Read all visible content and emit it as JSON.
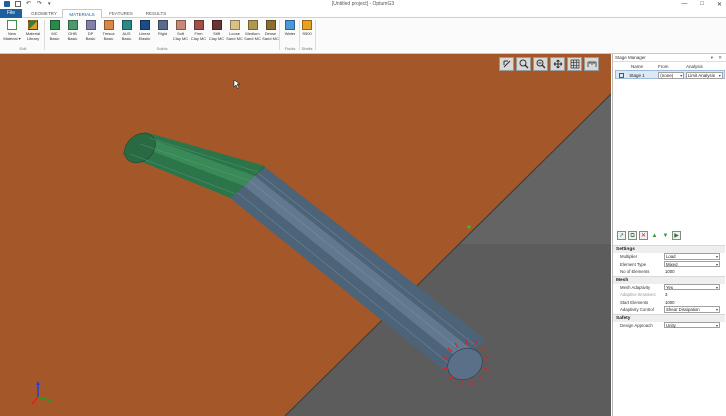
{
  "window": {
    "title": "[Untitled project] - OptumG3",
    "controls": [
      "—",
      "□",
      "✕"
    ]
  },
  "quick_access": [
    "app-icon",
    "save-icon",
    "undo-icon",
    "redo-icon",
    "dropdown-icon"
  ],
  "tabs": [
    {
      "label": "File"
    },
    {
      "label": "GEOMETRY"
    },
    {
      "label": "MATERIALS"
    },
    {
      "label": "FEATURES"
    },
    {
      "label": "RESULTS"
    }
  ],
  "active_tab": "MATERIALS",
  "ribbon": {
    "edit": {
      "group_label": "Edit",
      "new_material": [
        "New",
        "Material ▾"
      ],
      "material_library": [
        "Material",
        "Library"
      ]
    },
    "solids": {
      "group_label": "Solids",
      "buttons": [
        {
          "lines": [
            "MC",
            "Basic"
          ],
          "color": "#2a8a4a"
        },
        {
          "lines": [
            "GHB",
            "Basic"
          ],
          "color": "#4a9a6a"
        },
        {
          "lines": [
            "DP",
            "Basic"
          ],
          "color": "#8080aa"
        },
        {
          "lines": [
            "Tresca",
            "Basic"
          ],
          "color": "#d88844"
        },
        {
          "lines": [
            "AUS",
            "Basic"
          ],
          "color": "#2a8a88"
        },
        {
          "lines": [
            "Linear",
            "Elastic"
          ],
          "color": "#1c4a8a"
        },
        {
          "lines": [
            "Rigid"
          ],
          "color": "#5a6a8a"
        },
        {
          "lines": [
            "Soft",
            "Clay MC"
          ],
          "color": "#c88878"
        },
        {
          "lines": [
            "Firm",
            "Clay MC"
          ],
          "color": "#a05048"
        },
        {
          "lines": [
            "Stiff",
            "Clay MC"
          ],
          "color": "#6a3530"
        },
        {
          "lines": [
            "Loose",
            "Sand MC"
          ],
          "color": "#d8c088"
        },
        {
          "lines": [
            "Medium",
            "Sand MC"
          ],
          "color": "#b09850"
        },
        {
          "lines": [
            "Dense",
            "Sand MC"
          ],
          "color": "#8a7030"
        }
      ]
    },
    "fluids": {
      "group_label": "Fluids",
      "buttons": [
        {
          "lines": [
            "Water"
          ],
          "color": "#4a98d8"
        }
      ]
    },
    "shells": {
      "group_label": "Shells",
      "buttons": [
        {
          "lines": [
            "S500"
          ],
          "color": "#e8a020"
        }
      ]
    }
  },
  "viewport": {
    "colors": {
      "ground": "#a4582a",
      "background": "#545454",
      "slope_face": "#6b6b6b",
      "pile_upper": "#2f7a48",
      "pile_lower": "#4e6478",
      "load_arrows": "#e02020"
    },
    "toolbar_icons": [
      "select-arrow-icon",
      "zoom-icon",
      "zoom-window-icon",
      "pan-icon",
      "grid-icon",
      "ruler-icon"
    ]
  },
  "stage_manager": {
    "title": "Stage Manager",
    "panel_buttons": "▾ ✕",
    "columns": [
      "Name",
      "From",
      "Analysis"
    ],
    "rows": [
      {
        "name": "Stage 1",
        "from": "(none)",
        "analysis": "Limit Analysis"
      }
    ],
    "toolbar_icons": [
      "add-stage-icon",
      "copy-stage-icon",
      "delete-stage-icon",
      "move-up-icon",
      "move-down-icon",
      "run-icon"
    ]
  },
  "properties": {
    "sections": [
      {
        "title": "Settings",
        "rows": [
          {
            "label": "Multiplier",
            "value": "Load",
            "dropdown": true
          },
          {
            "label": "Element Type",
            "value": "Mixed",
            "dropdown": true
          },
          {
            "label": "No of Elements",
            "value": "1000",
            "dropdown": false
          }
        ]
      },
      {
        "title": "Mesh",
        "rows": [
          {
            "label": "Mesh Adaptivity",
            "value": "Yes",
            "dropdown": true
          },
          {
            "label": "Adaptive Iterations",
            "value": "3",
            "dropdown": false,
            "disabled": true
          },
          {
            "label": "Start Elements",
            "value": "1000",
            "dropdown": false
          },
          {
            "label": "Adaptivity Control",
            "value": "Shear Dissipation",
            "dropdown": true
          }
        ]
      },
      {
        "title": "Safety",
        "rows": [
          {
            "label": "Design Approach",
            "value": "Unity",
            "dropdown": true
          }
        ]
      }
    ]
  }
}
